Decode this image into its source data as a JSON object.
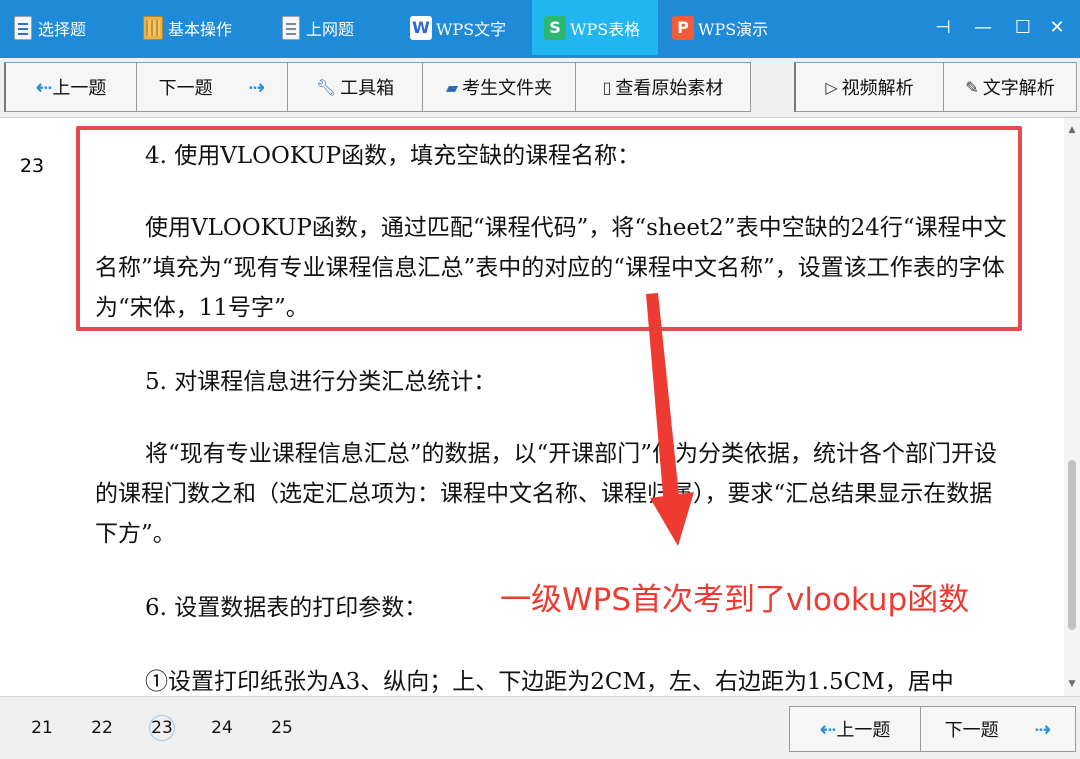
{
  "top_tabs": [
    {
      "label": "选择题",
      "icon": "document-icon"
    },
    {
      "label": "基本操作",
      "icon": "folder-icon"
    },
    {
      "label": "上网题",
      "icon": "document-icon"
    },
    {
      "label": "WPS文字",
      "icon": "wps-writer-icon",
      "glyph": "W"
    },
    {
      "label": "WPS表格",
      "icon": "wps-spreadsheet-icon",
      "glyph": "S",
      "active": true
    },
    {
      "label": "WPS演示",
      "icon": "wps-presentation-icon",
      "glyph": "P"
    }
  ],
  "window_controls": {
    "pin": "⊣",
    "minimize": "—",
    "maximize": "☐",
    "close": "✕"
  },
  "toolbar": {
    "prev": "上一题",
    "next": "下一题",
    "toolbox": "工具箱",
    "candidate_folder": "考生文件夹",
    "view_original": "查看原始素材",
    "video_analysis": "视频解析",
    "text_analysis": "文字解析"
  },
  "question": {
    "number": "23",
    "p1": "4. 使用VLOOKUP函数，填充空缺的课程名称：",
    "p2": "使用VLOOKUP函数，通过匹配“课程代码”，将“sheet2”表中空缺的24行“课程中文名称”填充为“现有专业课程信息汇总”表中的对应的“课程中文名称”，设置该工作表的字体为“宋体，11号字”。",
    "p3": "5. 对课程信息进行分类汇总统计：",
    "p4": "将“现有专业课程信息汇总”的数据，以“开课部门”作为分类依据，统计各个部门开设的课程门数之和（选定汇总项为：课程中文名称、课程归属），要求“汇总结果显示在数据下方”。",
    "p5": "6. 设置数据表的打印参数：",
    "p6": "①设置打印纸张为A3、纵向；上、下边距为2CM，左、右边距为1.5CM，居中"
  },
  "annotation": "一级WPS首次考到了vlookup函数",
  "bottom": {
    "question_links": [
      "21",
      "22",
      "23",
      "24",
      "25"
    ],
    "current": "23",
    "prev": "上一题",
    "next": "下一题"
  },
  "colors": {
    "topbar": "#1f8ad8",
    "active_tab": "#22b6f0",
    "highlight_red": "#e44a52",
    "annotation_red": "#ee3a30",
    "arrow_blue": "#2a8fd8"
  }
}
